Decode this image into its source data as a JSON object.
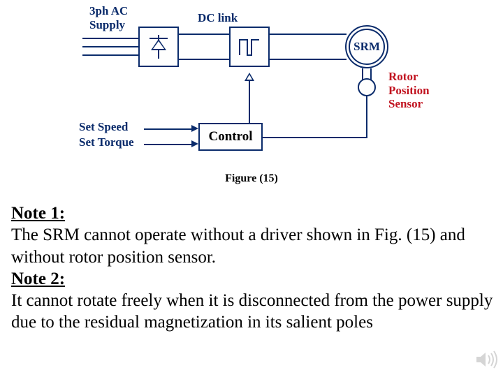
{
  "diagram": {
    "labels": {
      "supply": "3ph AC\nSupply",
      "dclink": "DC link",
      "srm": "SRM",
      "rotor_sensor": "Rotor\nPosition\nSensor",
      "set_speed": "Set Speed",
      "set_torque": "Set Torque",
      "control": "Control"
    },
    "caption": "Figure (15)"
  },
  "notes": {
    "n1_heading": "Note 1:",
    "n1_body": "The SRM cannot operate without a driver shown in Fig. (15) and without rotor position sensor.",
    "n2_heading": "Note 2:",
    "n2_body": "It cannot rotate freely when it is disconnected from the power supply due to the residual magnetization in its salient poles"
  }
}
